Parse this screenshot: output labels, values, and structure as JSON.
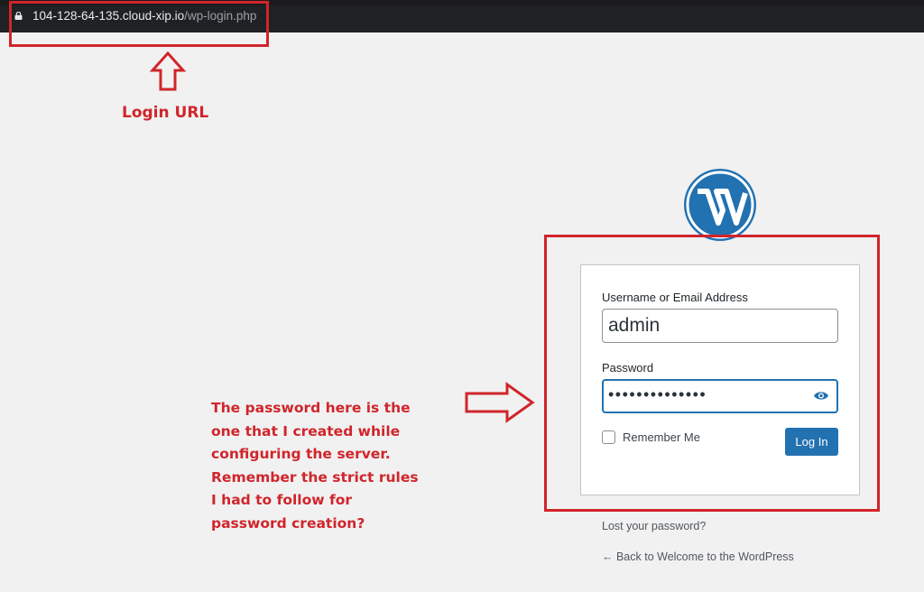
{
  "browser": {
    "url_host": "104-128-64-135.cloud-xip.io",
    "url_path": "/wp-login.php",
    "lock_icon": "lock-icon"
  },
  "annotations": {
    "login_url_label": "Login URL",
    "password_note": "The password here is the one that I created while configuring the server. Remember the strict rules I had to follow for password creation?",
    "color": "#d0252b"
  },
  "login_form": {
    "username_label": "Username or Email Address",
    "username_value": "admin",
    "password_label": "Password",
    "password_value": "••••••••••••••",
    "show_password_icon": "eye-icon",
    "remember_label": "Remember Me",
    "remember_checked": false,
    "submit_label": "Log In",
    "accent_color": "#2271b1"
  },
  "links": {
    "lost_password": "Lost your password?",
    "back_to_site": "← Back to Welcome to the WordPress"
  }
}
